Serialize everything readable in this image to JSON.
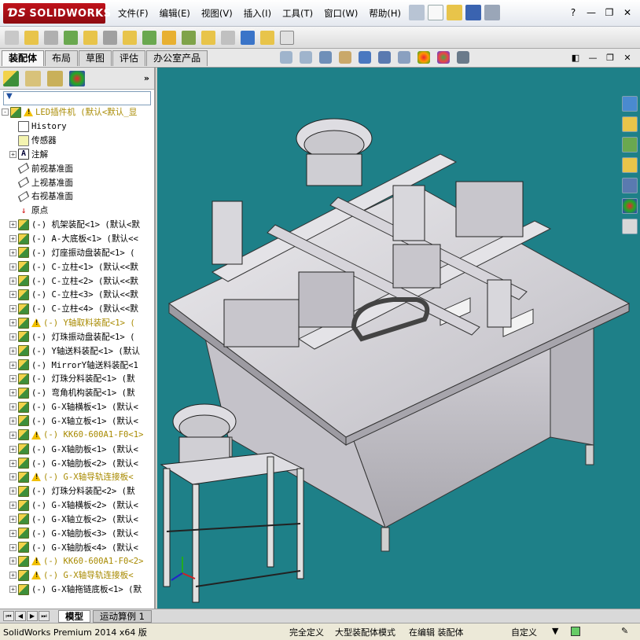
{
  "app": {
    "logo_text": "SOLIDWORKS",
    "menus": [
      "文件(F)",
      "编辑(E)",
      "视图(V)",
      "插入(I)",
      "工具(T)",
      "窗口(W)",
      "帮助(H)"
    ],
    "window_controls": [
      "?",
      "—",
      "❐",
      "✕"
    ]
  },
  "command_tabs": [
    "装配体",
    "布局",
    "草图",
    "评估",
    "办公室产品"
  ],
  "active_tab": "装配体",
  "feature_tree": {
    "panel_more": "»",
    "rows": [
      {
        "label": "LED插件机  (默认<默认_显",
        "icon": "asm",
        "warn": true,
        "expander": "-",
        "root": true
      },
      {
        "label": "History",
        "icon": "hist",
        "warn": false,
        "expander": ""
      },
      {
        "label": "传感器",
        "icon": "sens",
        "warn": false,
        "expander": ""
      },
      {
        "label": "注解",
        "icon": "note",
        "warn": false,
        "expander": "+"
      },
      {
        "label": "前视基准面",
        "icon": "plane",
        "warn": false,
        "expander": ""
      },
      {
        "label": "上视基准面",
        "icon": "plane",
        "warn": false,
        "expander": ""
      },
      {
        "label": "右视基准面",
        "icon": "plane",
        "warn": false,
        "expander": ""
      },
      {
        "label": "原点",
        "icon": "origin",
        "warn": false,
        "expander": ""
      },
      {
        "label": "(-) 机架装配<1> (默认<默",
        "icon": "asm",
        "warn": false,
        "expander": "+"
      },
      {
        "label": "(-) A-大底板<1> (默认<<",
        "icon": "asm",
        "warn": false,
        "expander": "+"
      },
      {
        "label": "(-) 灯座振动盘装配<1> (",
        "icon": "asm",
        "warn": false,
        "expander": "+"
      },
      {
        "label": "(-) C-立柱<1> (默认<<默",
        "icon": "asm",
        "warn": false,
        "expander": "+"
      },
      {
        "label": "(-) C-立柱<2> (默认<<默",
        "icon": "asm",
        "warn": false,
        "expander": "+"
      },
      {
        "label": "(-) C-立柱<3> (默认<<默",
        "icon": "asm",
        "warn": false,
        "expander": "+"
      },
      {
        "label": "(-) C-立柱<4> (默认<<默",
        "icon": "asm",
        "warn": false,
        "expander": "+"
      },
      {
        "label": "(-) Y轴取料装配<1> (",
        "icon": "asm",
        "warn": true,
        "expander": "+"
      },
      {
        "label": "(-) 灯珠振动盘装配<1> (",
        "icon": "asm",
        "warn": false,
        "expander": "+"
      },
      {
        "label": "(-) Y轴送料装配<1> (默认",
        "icon": "asm",
        "warn": false,
        "expander": "+"
      },
      {
        "label": "(-) MirrorY轴送料装配<1",
        "icon": "asm",
        "warn": false,
        "expander": "+"
      },
      {
        "label": "(-) 灯珠分料装配<1> (默",
        "icon": "asm",
        "warn": false,
        "expander": "+"
      },
      {
        "label": "(-) 弯角机构装配<1> (默",
        "icon": "asm",
        "warn": false,
        "expander": "+"
      },
      {
        "label": "(-) G-X轴横板<1> (默认<",
        "icon": "asm",
        "warn": false,
        "expander": "+"
      },
      {
        "label": "(-) G-X轴立板<1> (默认<",
        "icon": "asm",
        "warn": false,
        "expander": "+"
      },
      {
        "label": "(-) KK60-600A1-F0<1>",
        "icon": "asm",
        "warn": true,
        "expander": "+"
      },
      {
        "label": "(-) G-X轴肋板<1> (默认<",
        "icon": "asm",
        "warn": false,
        "expander": "+"
      },
      {
        "label": "(-) G-X轴肋板<2> (默认<",
        "icon": "asm",
        "warn": false,
        "expander": "+"
      },
      {
        "label": "(-) G-X轴导轨连接板<",
        "icon": "asm",
        "warn": true,
        "expander": "+"
      },
      {
        "label": "(-) 灯珠分料装配<2> (默",
        "icon": "asm",
        "warn": false,
        "expander": "+"
      },
      {
        "label": "(-) G-X轴横板<2> (默认<",
        "icon": "asm",
        "warn": false,
        "expander": "+"
      },
      {
        "label": "(-) G-X轴立板<2> (默认<",
        "icon": "asm",
        "warn": false,
        "expander": "+"
      },
      {
        "label": "(-) G-X轴肋板<3> (默认<",
        "icon": "asm",
        "warn": false,
        "expander": "+"
      },
      {
        "label": "(-) G-X轴肋板<4> (默认<",
        "icon": "asm",
        "warn": false,
        "expander": "+"
      },
      {
        "label": "(-) KK60-600A1-F0<2>",
        "icon": "asm",
        "warn": true,
        "expander": "+"
      },
      {
        "label": "(-) G-X轴导轨连接板<",
        "icon": "asm",
        "warn": true,
        "expander": "+"
      },
      {
        "label": "(-) G-X轴拖链底板<1> (默",
        "icon": "asm",
        "warn": false,
        "expander": "+"
      }
    ]
  },
  "bottom_tabs": [
    "模型",
    "运动算例 1"
  ],
  "status_bar": {
    "product": "SolidWorks Premium 2014 x64 版",
    "fully_defined": "完全定义",
    "large_assembly": "大型装配体模式",
    "editing": "在编辑 装配体",
    "units": "自定义"
  },
  "colors": {
    "viewport_bg": "#1e8088",
    "model_body": "#d2d0d4",
    "warning": "#f2c000",
    "logo_red": "#c0121a"
  }
}
